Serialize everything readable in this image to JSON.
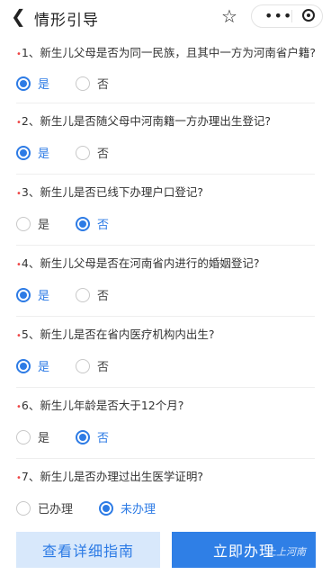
{
  "header": {
    "back_icon": "chevron-left-icon",
    "title": "情形引导"
  },
  "questions": [
    {
      "text": "1、新生儿父母是否为同一民族，且其中一方为河南省户籍?",
      "options": [
        {
          "label": "是",
          "selected": true
        },
        {
          "label": "否",
          "selected": false
        }
      ]
    },
    {
      "text": "2、新生儿是否随父母中河南籍一方办理出生登记?",
      "options": [
        {
          "label": "是",
          "selected": true
        },
        {
          "label": "否",
          "selected": false
        }
      ]
    },
    {
      "text": "3、新生儿是否已线下办理户口登记?",
      "options": [
        {
          "label": "是",
          "selected": false
        },
        {
          "label": "否",
          "selected": true
        }
      ]
    },
    {
      "text": "4、新生儿父母是否在河南省内进行的婚姻登记?",
      "options": [
        {
          "label": "是",
          "selected": true
        },
        {
          "label": "否",
          "selected": false
        }
      ]
    },
    {
      "text": "5、新生儿是否在省内医疗机构内出生?",
      "options": [
        {
          "label": "是",
          "selected": true
        },
        {
          "label": "否",
          "selected": false
        }
      ]
    },
    {
      "text": "6、新生儿年龄是否大于12个月?",
      "options": [
        {
          "label": "是",
          "selected": false
        },
        {
          "label": "否",
          "selected": true
        }
      ]
    },
    {
      "text": "7、新生儿是否办理过出生医学证明?",
      "options": [
        {
          "label": "已办理",
          "selected": false
        },
        {
          "label": "未办理",
          "selected": true
        }
      ]
    }
  ],
  "buttons": {
    "guide": "查看详细指南",
    "apply": "立即办理"
  },
  "watermark": "上上河南",
  "colors": {
    "accent": "#2d7be5",
    "asterisk": "#ee4444"
  }
}
